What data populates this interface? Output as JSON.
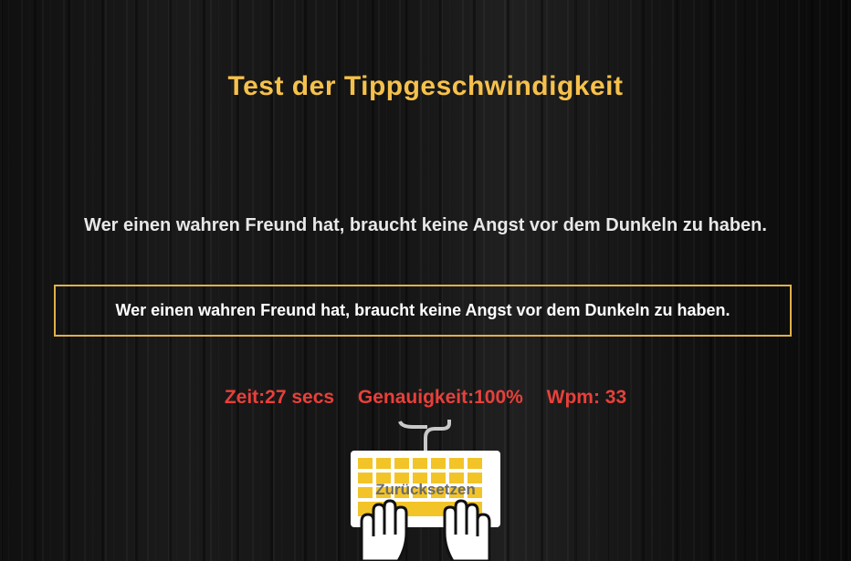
{
  "title": "Test der Tippgeschwindigkeit",
  "quote": "Wer einen wahren Freund hat, braucht keine Angst vor dem Dunkeln zu haben.",
  "input": {
    "value": "Wer einen wahren Freund hat, braucht keine Angst vor dem Dunkeln zu haben."
  },
  "stats": {
    "time": "Zeit:27 secs",
    "accuracy": "Genauigkeit:100%",
    "wpm": "Wpm: 33"
  },
  "reset_button": {
    "label": "Zurücksetzen",
    "icon": "keyboard-hands-icon"
  },
  "colors": {
    "title": "#f6c14b",
    "stats": "#e8403a",
    "border": "#e0b04c",
    "keys": "#f2c428"
  }
}
